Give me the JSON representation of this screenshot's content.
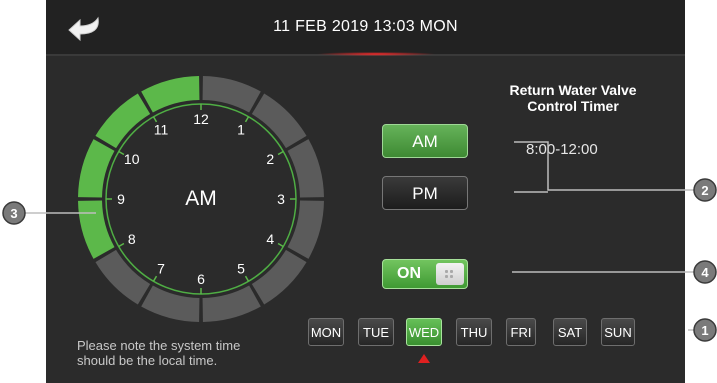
{
  "header": {
    "datetime": "11 FEB 2019 13:03 MON",
    "back_icon": "back-arrow-icon"
  },
  "timer": {
    "title_line1": "Return Water Valve",
    "title_line2": "Control Timer",
    "schedule": "8:00-12:00",
    "period_label": "AM",
    "am_label": "AM",
    "pm_label": "PM",
    "selected_period": "AM",
    "active_hours": [
      8,
      9,
      10,
      11
    ],
    "switch_label": "ON",
    "switch_on": true
  },
  "clock": {
    "numbers": [
      "12",
      "1",
      "2",
      "3",
      "4",
      "5",
      "6",
      "7",
      "8",
      "9",
      "10",
      "11"
    ]
  },
  "days": {
    "items": [
      "MON",
      "TUE",
      "WED",
      "THU",
      "FRI",
      "SAT",
      "SUN"
    ],
    "selected": "WED"
  },
  "note": {
    "line1": "Please note the system time",
    "line2": "should be the local time."
  },
  "callouts": [
    "1",
    "2",
    "3",
    "4"
  ],
  "colors": {
    "active_green": "#5cb84a",
    "inactive_gray": "#5b5b5b",
    "background": "#2b2b2b",
    "marker_red": "#e02020"
  }
}
